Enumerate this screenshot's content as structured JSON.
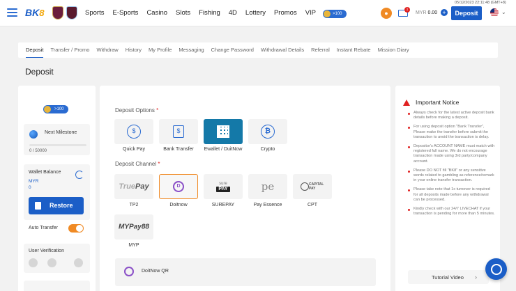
{
  "header": {
    "logo_text": "BK8",
    "datetime": "05/12/2023 22:11:48 (GMT+8)",
    "nav": [
      "Sports",
      "E-Sports",
      "Casino",
      "Slots",
      "Fishing",
      "4D",
      "Lottery",
      "Promos",
      "VIP"
    ],
    "coin_badge": ">100",
    "notifications_count": "1",
    "balance_label": "MYR",
    "balance_value": "0.00",
    "deposit_label": "Deposit",
    "accent": "#1b5ec7"
  },
  "tabs": [
    {
      "label": "Deposit",
      "active": true
    },
    {
      "label": "Transfer / Promo"
    },
    {
      "label": "Withdraw"
    },
    {
      "label": "History"
    },
    {
      "label": "My Profile"
    },
    {
      "label": "Messaging"
    },
    {
      "label": "Change Password"
    },
    {
      "label": "Withdrawal Details"
    },
    {
      "label": "Referral"
    },
    {
      "label": "Instant Rebate"
    },
    {
      "label": "Mission Diary"
    }
  ],
  "page_title": "Deposit",
  "left_panel": {
    "coin_badge": ">100",
    "milestone_label": "Next Milestone",
    "milestone_value": "0 / 50000",
    "wallet_label": "Wallet Balance",
    "wallet_currency": "MYR",
    "wallet_amount": "0",
    "restore_label": "Restore",
    "auto_transfer_label": "Auto Transfer",
    "auto_transfer_on": true,
    "verification_label": "User Verification"
  },
  "deposit_options": {
    "label": "Deposit Options",
    "required_mark": "*",
    "items": [
      {
        "label": "Quick Pay",
        "icon": "coin-icon"
      },
      {
        "label": "Bank Transfer",
        "icon": "bank-icon"
      },
      {
        "label": "Ewallet / DuitNow",
        "icon": "qr-icon",
        "selected": true
      },
      {
        "label": "Crypto",
        "icon": "bitcoin-icon"
      }
    ]
  },
  "deposit_channel": {
    "label": "Deposit Channel",
    "required_mark": "*",
    "items": [
      {
        "label": "TP2",
        "logo_a": "True",
        "logo_b": "Pay"
      },
      {
        "label": "Doitnow",
        "logo": "D",
        "selected": true
      },
      {
        "label": "SUREPAY",
        "logo_a": "sure",
        "logo_b": "PAY"
      },
      {
        "label": "Pay Essence",
        "logo": "pe"
      },
      {
        "label": "CPT",
        "logo": "CAPITAL PAY"
      },
      {
        "label": "MYP",
        "logo": "MYPay88"
      }
    ]
  },
  "qr_method": {
    "label": "DoitNow QR"
  },
  "notice": {
    "title": "Important Notice",
    "items": [
      "Always check for the latest active deposit bank details before making a deposit.",
      "For using deposit option \"Bank Transfer\", Please make the transfer before submit the transaction to avoid the transaction is delay.",
      "Depositor's ACCOUNT NAME must match with registered full name. We do not encourage transaction made using 3rd party/company account.",
      "Please DO NOT fill \"BK8\" or any sensitive words related to gambling as reference/remark in your online transfer transaction.",
      "Please take note that 1x turnover is required for all deposits made before any withdrawal can be processed.",
      "Kindly check with our 24/7 LIVECHAT if your transaction is pending for more than 5 minutes."
    ],
    "tutorial_label": "Tutorial Video"
  }
}
